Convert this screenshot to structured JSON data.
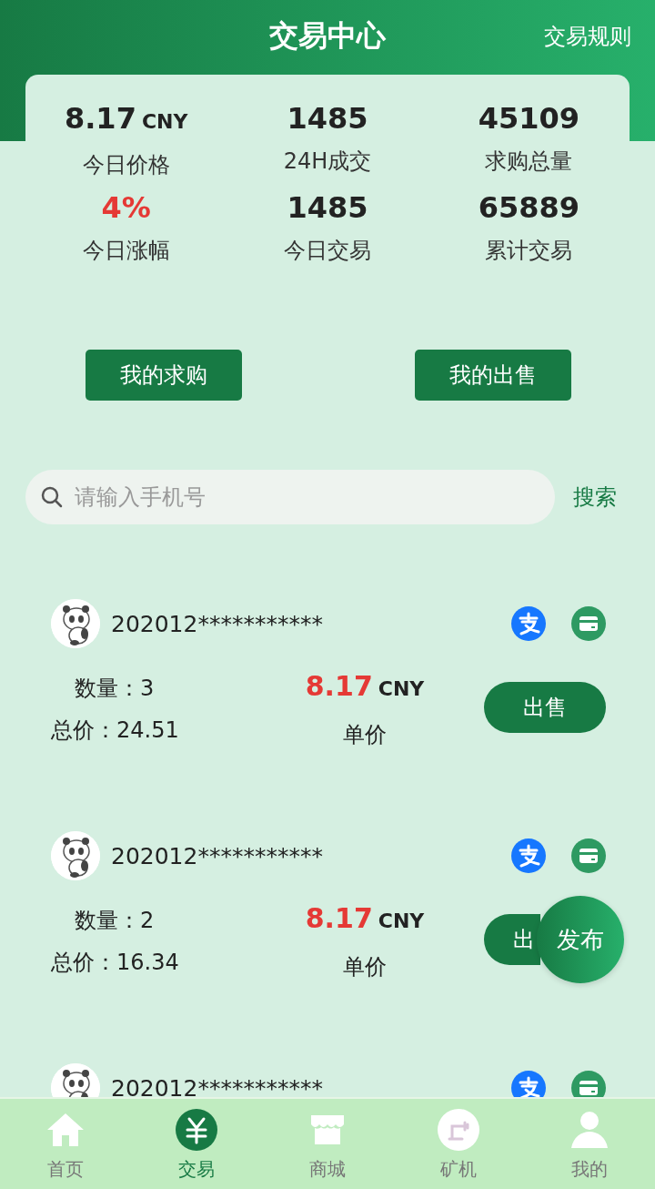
{
  "header": {
    "title": "交易中心",
    "rules_link": "交易规则"
  },
  "stats": [
    {
      "value": "8.17",
      "unit": "CNY",
      "label": "今日价格",
      "color": "#222222"
    },
    {
      "value": "1485",
      "label": "24H成交",
      "color": "#222222"
    },
    {
      "value": "45109",
      "label": "求购总量",
      "color": "#222222"
    },
    {
      "value": "4%",
      "label": "今日涨幅",
      "color": "#e53935"
    },
    {
      "value": "1485",
      "label": "今日交易",
      "color": "#222222"
    },
    {
      "value": "65889",
      "label": "累计交易",
      "color": "#222222"
    }
  ],
  "actions": [
    "我的求购",
    "我的出售"
  ],
  "search": {
    "placeholder": "请输入手机号",
    "button": "搜索"
  },
  "orders": [
    {
      "user": "202012***********",
      "quantity": "数量：3",
      "total": "总价：24.51",
      "price": "8.17",
      "unit": "CNY",
      "price_label": "单价",
      "action": "出售"
    },
    {
      "user": "202012***********",
      "quantity": "数量：2",
      "total": "总价：16.34",
      "price": "8.17",
      "unit": "CNY",
      "price_label": "单价",
      "action": "出"
    },
    {
      "user": "202012***********"
    }
  ],
  "publish_button": "发布",
  "nav": [
    {
      "kind": "home",
      "label": "首页",
      "selected": false
    },
    {
      "kind": "trade",
      "label": "交易",
      "selected": true
    },
    {
      "kind": "shop",
      "label": "商城",
      "selected": false
    },
    {
      "kind": "miner",
      "label": "矿机",
      "selected": false
    },
    {
      "kind": "me",
      "label": "我的",
      "selected": false
    }
  ]
}
